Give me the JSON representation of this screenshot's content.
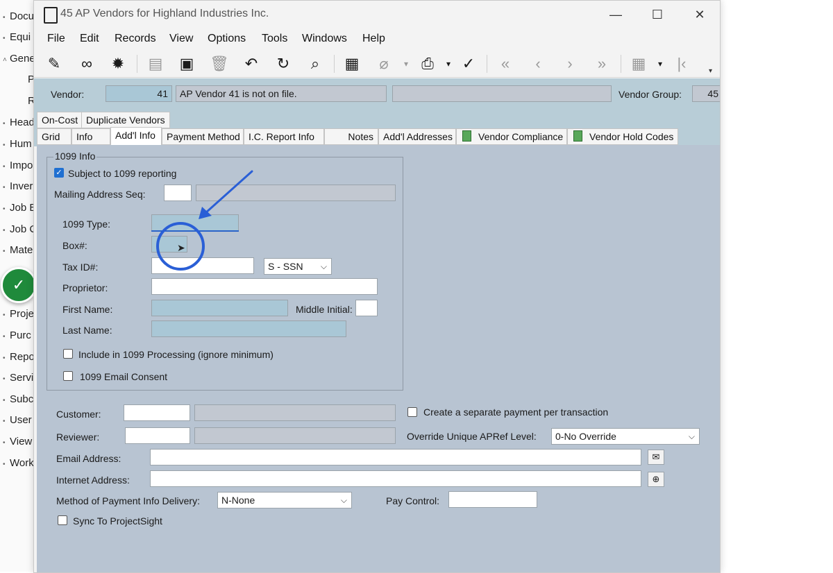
{
  "background_nav": {
    "items": [
      {
        "label": "Docu",
        "marker": "•"
      },
      {
        "label": "Equi",
        "marker": "•"
      },
      {
        "label": "Gene",
        "marker": "˄"
      },
      {
        "label": "P",
        "marker": ""
      },
      {
        "label": "R",
        "marker": ""
      },
      {
        "label": "Head",
        "marker": "•"
      },
      {
        "label": "Hum",
        "marker": "•"
      },
      {
        "label": "Impo",
        "marker": "•"
      },
      {
        "label": "Inver",
        "marker": "•"
      },
      {
        "label": "Job E",
        "marker": "•"
      },
      {
        "label": "Job C",
        "marker": "•"
      },
      {
        "label": "Mate",
        "marker": "•"
      },
      {
        "label": "Proje",
        "marker": "•"
      },
      {
        "label": "Purc",
        "marker": "•"
      },
      {
        "label": "Repo",
        "marker": "•"
      },
      {
        "label": "Servi",
        "marker": "•"
      },
      {
        "label": "Subc",
        "marker": "•"
      },
      {
        "label": "User",
        "marker": "•"
      },
      {
        "label": "View",
        "marker": "•"
      },
      {
        "label": "Work",
        "marker": "•"
      }
    ],
    "badge_icon": "check-icon",
    "badge_color": "#1f8a3b"
  },
  "window": {
    "title": "45 AP Vendors for Highland Industries Inc.",
    "controls": {
      "minimize": "—",
      "maximize": "☐",
      "close": "✕"
    }
  },
  "menu": [
    "File",
    "Edit",
    "Records",
    "View",
    "Options",
    "Tools",
    "Windows",
    "Help"
  ],
  "toolbar": [
    {
      "icon": "edit-note-icon",
      "glyph": "✎"
    },
    {
      "icon": "binoculars-icon",
      "glyph": "∞"
    },
    {
      "icon": "settings-burst-icon",
      "glyph": "✹"
    },
    {
      "icon": "new-document-icon",
      "glyph": "▤"
    },
    {
      "icon": "save-icon",
      "glyph": "▣"
    },
    {
      "icon": "delete-icon",
      "glyph": "🗑"
    },
    {
      "icon": "undo-icon",
      "glyph": "↶"
    },
    {
      "icon": "refresh-icon",
      "glyph": "↻"
    },
    {
      "icon": "search-icon",
      "glyph": "⌕"
    },
    {
      "icon": "calculator-icon",
      "glyph": "▦"
    },
    {
      "icon": "attach-icon",
      "glyph": "⌀"
    },
    {
      "icon": "print-icon",
      "glyph": "⎙"
    },
    {
      "icon": "spellcheck-icon",
      "glyph": "✓"
    },
    {
      "icon": "first-record-icon",
      "glyph": "«"
    },
    {
      "icon": "previous-record-icon",
      "glyph": "‹"
    },
    {
      "icon": "next-record-icon",
      "glyph": "›"
    },
    {
      "icon": "last-record-icon",
      "glyph": "»"
    },
    {
      "icon": "grid-settings-icon",
      "glyph": "▦"
    },
    {
      "icon": "collapse-left-icon",
      "glyph": "|‹"
    }
  ],
  "vendor": {
    "label": "Vendor:",
    "number": "41",
    "status": "AP Vendor 41 is not on file.",
    "extra": "",
    "group_label": "Vendor Group:",
    "group_value": "45"
  },
  "tabs_row1": [
    "On-Cost",
    "Duplicate Vendors"
  ],
  "tabs_row2": [
    "Grid",
    "Info",
    "Add'l Info",
    "Payment Method",
    "I.C. Report Info",
    "Notes",
    "Add'l Addresses",
    "Vendor Compliance",
    "Vendor Hold Codes"
  ],
  "form_1099": {
    "group_title": "1099 Info",
    "subject_label": "Subject to 1099 reporting",
    "subject_checked": true,
    "mailing_seq_label": "Mailing Address Seq:",
    "mailing_seq_value": "",
    "mailing_seq_desc": "",
    "type_label": "1099 Type:",
    "type_value": "",
    "box_label": "Box#:",
    "box_value": "",
    "taxid_label": "Tax ID#:",
    "taxid_value": "",
    "taxid_kind": "S - SSN",
    "proprietor_label": "Proprietor:",
    "proprietor_value": "",
    "first_name_label": "First Name:",
    "first_name_value": "",
    "middle_initial_label": "Middle Initial:",
    "middle_initial_value": "",
    "last_name_label": "Last Name:",
    "last_name_value": "",
    "include_label": "Include in 1099 Processing (ignore minimum)",
    "include_checked": false,
    "email_consent_label": "1099 Email Consent",
    "email_consent_checked": false
  },
  "form_other": {
    "customer_label": "Customer:",
    "customer_value": "",
    "customer_desc": "",
    "separate_payment_label": "Create a separate payment per transaction",
    "separate_payment_checked": false,
    "reviewer_label": "Reviewer:",
    "reviewer_value": "",
    "reviewer_desc": "",
    "override_label": "Override Unique APRef Level:",
    "override_value": "0-No Override",
    "email_label": "Email Address:",
    "email_value": "",
    "internet_label": "Internet Address:",
    "internet_value": "",
    "delivery_label": "Method of Payment Info Delivery:",
    "delivery_value": "N-None",
    "pay_control_label": "Pay Control:",
    "pay_control_value": "",
    "sync_label": "Sync To ProjectSight",
    "sync_checked": false
  },
  "colors": {
    "panel": "#b8c4d2",
    "header": "#b8cdd7",
    "required_field": "#a9c7d6",
    "annotation": "#2a5fd6"
  }
}
